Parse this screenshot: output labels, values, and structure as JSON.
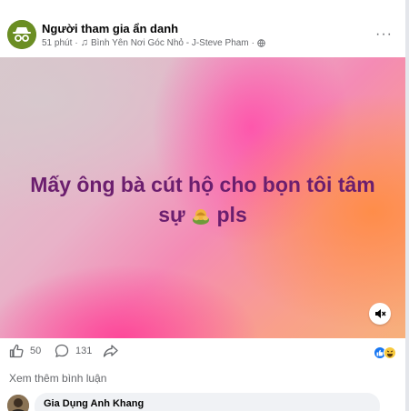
{
  "post": {
    "author": "Người tham gia ẩn danh",
    "time": "51 phút",
    "separator": "·",
    "group": "Bình Yên Nơi Góc Nhỏ - J-Steve Pham",
    "more_label": "···"
  },
  "media": {
    "caption_line1": "Mấy ông bà cút hộ cho bọn tôi tâm",
    "caption_line2_before": "sự",
    "caption_line2_after": "pls"
  },
  "actions": {
    "like_count": "50",
    "comment_count": "131"
  },
  "comments": {
    "see_more": "Xem thêm bình luận",
    "first_commenter": "Gia Dụng Anh Khang"
  },
  "colors": {
    "caption": "#6b1e6e",
    "meta": "#65676b",
    "like_blue": "#1877f2",
    "haha_yellow": "#f7c93c"
  },
  "icons": [
    "incognito-avatar-icon",
    "music-note-icon",
    "globe-icon",
    "more-icon",
    "hide-face-emoji-icon",
    "mute-icon",
    "like-icon",
    "comment-icon",
    "share-icon",
    "like-reaction-icon",
    "haha-reaction-icon"
  ]
}
